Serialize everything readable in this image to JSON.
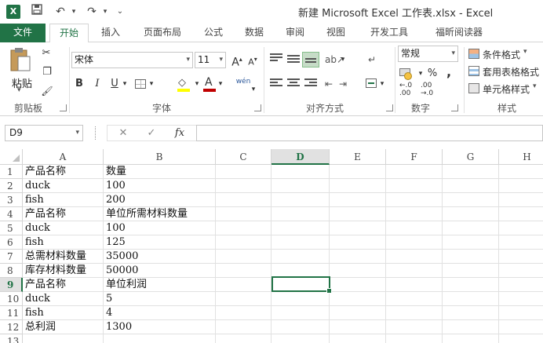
{
  "titlebar": {
    "logo": "X",
    "title": "新建 Microsoft Excel 工作表.xlsx - Excel",
    "save_icon": "💾",
    "undo_icon": "↶",
    "redo_icon": "↷",
    "customize_icon": "⌄"
  },
  "tabs": [
    {
      "label": "文件"
    },
    {
      "label": "开始"
    },
    {
      "label": "插入"
    },
    {
      "label": "页面布局"
    },
    {
      "label": "公式"
    },
    {
      "label": "数据"
    },
    {
      "label": "审阅"
    },
    {
      "label": "视图"
    },
    {
      "label": "开发工具"
    },
    {
      "label": "福昕阅读器"
    }
  ],
  "ribbon": {
    "clipboard": {
      "label": "剪贴板",
      "paste": "粘贴"
    },
    "font": {
      "label": "字体",
      "family": "宋体",
      "size": "11",
      "bold": "B",
      "italic": "I",
      "underline": "U",
      "grow": "A",
      "shrink": "A",
      "fill_letter": "A",
      "color_letter": "A",
      "wen": "wén"
    },
    "alignment": {
      "label": "对齐方式"
    },
    "number": {
      "label": "数字",
      "format": "常规",
      "percent": "%",
      "comma": ","
    },
    "styles": {
      "label": "样式",
      "conditional": "条件格式",
      "table": "套用表格格式",
      "cell": "单元格样式"
    }
  },
  "formula_bar": {
    "name_box": "D9",
    "cancel": "✕",
    "enter": "✓",
    "fx": "fx",
    "value": ""
  },
  "columns": [
    "A",
    "B",
    "C",
    "D",
    "E",
    "F",
    "G",
    "H"
  ],
  "selected_column": "D",
  "selected_row": "9",
  "rows": [
    {
      "n": "1",
      "a": "产品名称",
      "b": "数量"
    },
    {
      "n": "2",
      "a": "duck",
      "b": "100"
    },
    {
      "n": "3",
      "a": "fish",
      "b": "200"
    },
    {
      "n": "4",
      "a": "产品名称",
      "b": "单位所需材料数量"
    },
    {
      "n": "5",
      "a": "duck",
      "b": "100"
    },
    {
      "n": "6",
      "a": "fish",
      "b": "125"
    },
    {
      "n": "7",
      "a": "总需材料数量",
      "b": "35000"
    },
    {
      "n": "8",
      "a": "库存材料数量",
      "b": "50000"
    },
    {
      "n": "9",
      "a": "产品名称",
      "b": "单位利润"
    },
    {
      "n": "10",
      "a": "duck",
      "b": "5"
    },
    {
      "n": "11",
      "a": "fish",
      "b": "4"
    },
    {
      "n": "12",
      "a": "总利润",
      "b": "1300"
    },
    {
      "n": "13",
      "a": "",
      "b": ""
    }
  ],
  "colors": {
    "accent": "#217346",
    "font_fill": "#ffff00",
    "font_color": "#c00000"
  }
}
